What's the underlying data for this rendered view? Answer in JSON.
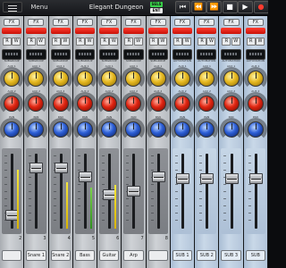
{
  "topbar": {
    "menu_label": "Menu",
    "song_title": "Elegant Dungeon",
    "tags": [
      {
        "label": "SELS",
        "color": "#39d24a"
      },
      {
        "label": "ENT",
        "color": "#e6e6e6"
      }
    ],
    "controls": [
      {
        "icon": "rewind-to-start-icon"
      },
      {
        "icon": "rewind-icon"
      },
      {
        "icon": "fast-forward-icon"
      },
      {
        "icon": "stop-icon"
      },
      {
        "icon": "play-icon"
      },
      {
        "icon": "record-icon"
      }
    ]
  },
  "common": {
    "fx_label": "FX",
    "read_label": "R",
    "write_label": "W",
    "subgroup_label": "SUBGROUP",
    "automation_label": "AUTOMATION",
    "aux1_label": "AUX 1",
    "aux2_label": "AUX 2",
    "pan_label": "PAN"
  },
  "channels": [
    {
      "name": "",
      "number": "2",
      "type": "track",
      "meter_color": "yellow",
      "meter_level": 0.78,
      "fader_level": 0.12
    },
    {
      "name": "Snare 1",
      "number": "3",
      "type": "track",
      "meter_color": "yellow",
      "meter_level": 0.0,
      "fader_level": 0.86
    },
    {
      "name": "Snare 2",
      "number": "4",
      "type": "track",
      "meter_color": "yellow",
      "meter_level": 0.62,
      "fader_level": 0.86
    },
    {
      "name": "Bass",
      "number": "5",
      "type": "track",
      "meter_color": "green",
      "meter_level": 0.55,
      "fader_level": 0.72
    },
    {
      "name": "Guitar",
      "number": "6",
      "type": "track",
      "meter_color": "yellow",
      "meter_level": 0.58,
      "fader_level": 0.45
    },
    {
      "name": "Arp",
      "number": "7",
      "type": "track",
      "meter_color": "yellow",
      "meter_level": 0.0,
      "fader_level": 0.5
    },
    {
      "name": "",
      "number": "8",
      "type": "track",
      "meter_color": "yellow",
      "meter_level": 0.0,
      "fader_level": 0.72
    },
    {
      "name": "SUB 1",
      "number": "",
      "type": "sub",
      "meter_color": "yellow",
      "meter_level": 0.0,
      "fader_level": 0.7
    },
    {
      "name": "SUB 2",
      "number": "",
      "type": "sub",
      "meter_color": "yellow",
      "meter_level": 0.0,
      "fader_level": 0.7
    },
    {
      "name": "SUB 3",
      "number": "",
      "type": "sub",
      "meter_color": "yellow",
      "meter_level": 0.0,
      "fader_level": 0.7
    },
    {
      "name": "SUB",
      "number": "",
      "type": "sub",
      "meter_color": "yellow",
      "meter_level": 0.0,
      "fader_level": 0.7
    }
  ]
}
